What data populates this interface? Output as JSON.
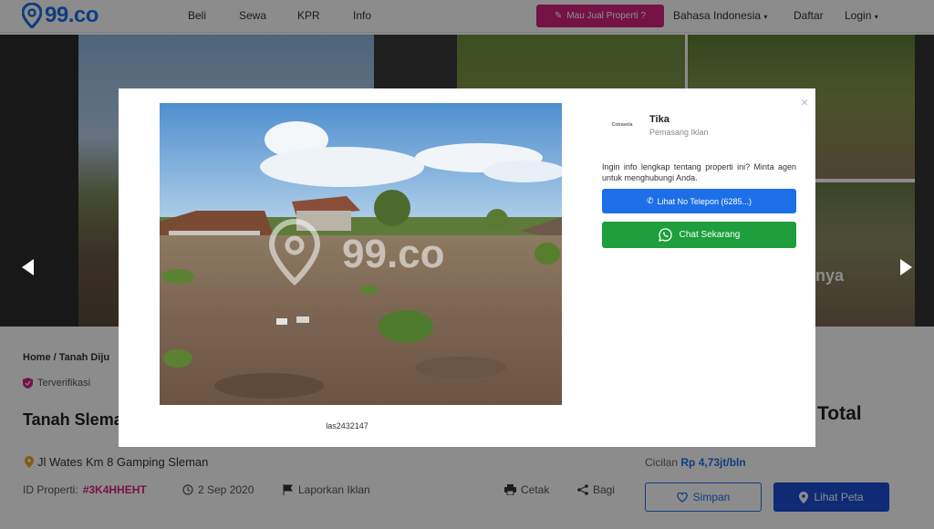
{
  "nav": {
    "logo_text": "99.co",
    "links": [
      "Beli",
      "Sewa",
      "KPR",
      "Info"
    ],
    "sell_button": "Mau Jual Properti ?",
    "language": "Bahasa Indonesia",
    "register": "Daftar",
    "login": "Login"
  },
  "gallery": {
    "overlay_text": "nya"
  },
  "listing": {
    "breadcrumb": "Home  /  Tanah Diju",
    "verified_label": "Terverifikasi",
    "title": "Tanah Slema",
    "price_suffix": "Total",
    "address": "Jl Wates Km 8 Gamping Sleman",
    "id_label": "ID Properti:",
    "id_value": "#3K4HHEHT",
    "date": "2 Sep 2020",
    "report": "Laporkan Iklan",
    "print": "Cetak",
    "share": "Bagi",
    "installment_label": "Cicilan",
    "installment_value": "Rp 4,73jt/bln",
    "save_button": "Simpan",
    "map_button": "Lihat Peta"
  },
  "modal": {
    "image_caption": "las2432147",
    "watermark": "99.co",
    "agent_logo_text": "Cotravela",
    "agent_name": "Tika",
    "agent_role": "Pemasang Iklan",
    "message": "Ingin info lengkap tentang properti ini? Minta agen untuk menghubungi Anda.",
    "phone_button": "Lihat No Telepon (6285...)",
    "chat_button": "Chat Sekarang",
    "close_symbol": "×"
  },
  "colors": {
    "brand_blue": "#1c6fe8",
    "brand_pink": "#d6247e",
    "whatsapp_green": "#1e9e3c"
  }
}
